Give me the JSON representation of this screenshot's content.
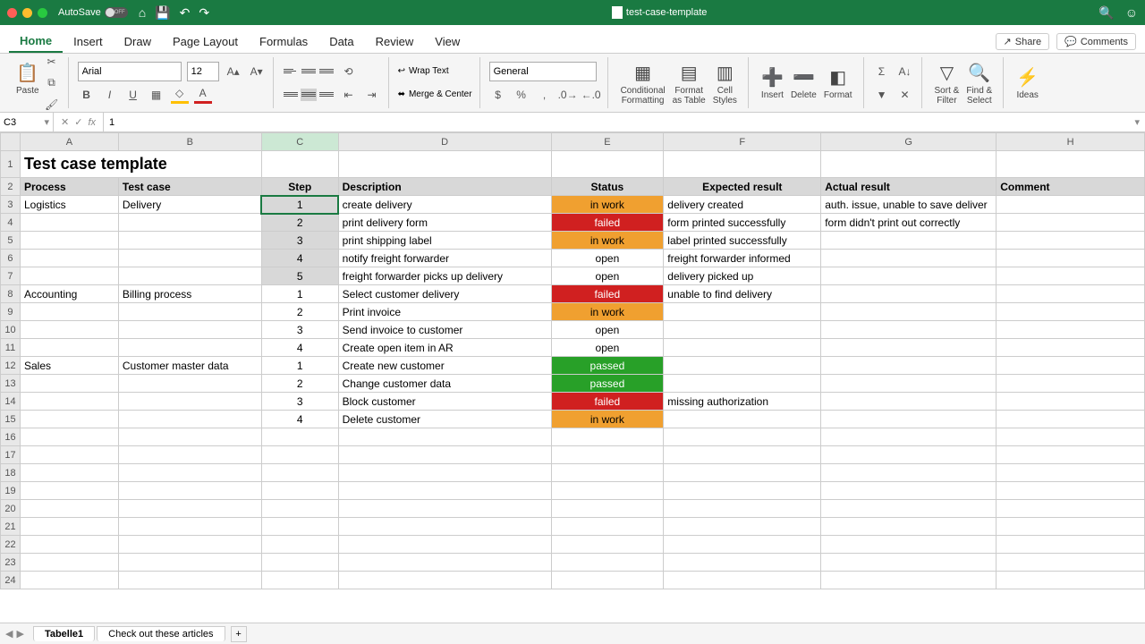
{
  "titlebar": {
    "autosave_label": "AutoSave",
    "autosave_state": "OFF",
    "doc_name": "test-case-template"
  },
  "tabs": {
    "items": [
      "Home",
      "Insert",
      "Draw",
      "Page Layout",
      "Formulas",
      "Data",
      "Review",
      "View"
    ],
    "active": "Home",
    "share": "Share",
    "comments": "Comments"
  },
  "ribbon": {
    "paste": "Paste",
    "font_name": "Arial",
    "font_size": "12",
    "wrap_text": "Wrap Text",
    "merge_center": "Merge & Center",
    "number_format": "General",
    "cond_fmt": "Conditional\nFormatting",
    "fmt_table": "Format\nas Table",
    "cell_styles": "Cell\nStyles",
    "insert": "Insert",
    "delete": "Delete",
    "format": "Format",
    "sort_filter": "Sort &\nFilter",
    "find_select": "Find &\nSelect",
    "ideas": "Ideas"
  },
  "formula": {
    "name_box": "C3",
    "fx": "fx",
    "value": "1"
  },
  "grid": {
    "columns": [
      "A",
      "B",
      "C",
      "D",
      "E",
      "F",
      "G",
      "H"
    ],
    "title": "Test case template",
    "headers": [
      "Process",
      "Test case",
      "Step",
      "Description",
      "Status",
      "Expected result",
      "Actual result",
      "Comment"
    ],
    "rows": [
      {
        "a": "Logistics",
        "b": "Delivery",
        "c": "1",
        "d": "create delivery",
        "e": "in work",
        "f": "delivery created",
        "g": "auth. issue, unable to save deliver",
        "h": ""
      },
      {
        "a": "",
        "b": "",
        "c": "2",
        "d": "print delivery form",
        "e": "failed",
        "f": "form printed successfully",
        "g": "form didn't print out correctly",
        "h": ""
      },
      {
        "a": "",
        "b": "",
        "c": "3",
        "d": "print shipping label",
        "e": "in work",
        "f": "label printed successfully",
        "g": "",
        "h": ""
      },
      {
        "a": "",
        "b": "",
        "c": "4",
        "d": "notify freight forwarder",
        "e": "open",
        "f": "freight forwarder informed",
        "g": "",
        "h": ""
      },
      {
        "a": "",
        "b": "",
        "c": "5",
        "d": "freight forwarder picks up delivery",
        "e": "open",
        "f": "delivery picked up",
        "g": "",
        "h": ""
      },
      {
        "a": "Accounting",
        "b": "Billing process",
        "c": "1",
        "d": "Select customer delivery",
        "e": "failed",
        "f": "unable to find delivery",
        "g": "",
        "h": ""
      },
      {
        "a": "",
        "b": "",
        "c": "2",
        "d": "Print invoice",
        "e": "in work",
        "f": "",
        "g": "",
        "h": ""
      },
      {
        "a": "",
        "b": "",
        "c": "3",
        "d": "Send invoice to customer",
        "e": "open",
        "f": "",
        "g": "",
        "h": ""
      },
      {
        "a": "",
        "b": "",
        "c": "4",
        "d": "Create open item in AR",
        "e": "open",
        "f": "",
        "g": "",
        "h": ""
      },
      {
        "a": "Sales",
        "b": "Customer master data",
        "c": "1",
        "d": "Create new customer",
        "e": "passed",
        "f": "",
        "g": "",
        "h": ""
      },
      {
        "a": "",
        "b": "",
        "c": "2",
        "d": "Change customer data",
        "e": "passed",
        "f": "",
        "g": "",
        "h": ""
      },
      {
        "a": "",
        "b": "",
        "c": "3",
        "d": "Block customer",
        "e": "failed",
        "f": "missing authorization",
        "g": "",
        "h": ""
      },
      {
        "a": "",
        "b": "",
        "c": "4",
        "d": "Delete customer",
        "e": "in work",
        "f": "",
        "g": "",
        "h": ""
      }
    ],
    "blank_rows": 9,
    "selected_col": "C",
    "selected_range_rows": [
      3,
      4,
      5,
      6,
      7
    ]
  },
  "sheets": {
    "tabs": [
      "Tabelle1",
      "Check out these articles"
    ],
    "active": "Tabelle1"
  }
}
